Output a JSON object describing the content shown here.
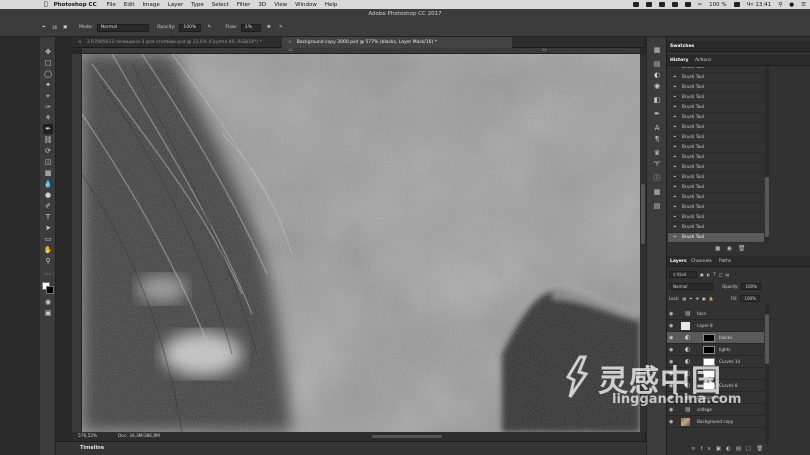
{
  "menubar": {
    "app_name": "Photoshop CC",
    "items": [
      "File",
      "Edit",
      "Image",
      "Layer",
      "Type",
      "Select",
      "Filter",
      "3D",
      "View",
      "Window",
      "Help"
    ],
    "battery": "100 %",
    "clock": "Чт 13:41"
  },
  "window": {
    "title": "Adobe Photoshop CC 2017"
  },
  "options_bar": {
    "brush_size": "16",
    "mode_label": "Mode:",
    "mode_value": "Normal",
    "opacity_label": "Opacity:",
    "opacity_value": "100%",
    "flow_label": "Flow:",
    "flow_value": "1%"
  },
  "tabs": [
    {
      "label": "3 R7005612-почищено-3 для стопбюк.psd @ 22,6% (Группа 40, RGB/16*) *"
    },
    {
      "label": "Background copy 3000.psd @ 577% (blacks, Layer Mask/16) *"
    }
  ],
  "ruler": {
    "tick_a": "13",
    "tick_b": "14"
  },
  "status": {
    "zoom": "576,53%",
    "doc": "Doc: 34,3M/386,8M"
  },
  "timeline": {
    "label": "Timeline"
  },
  "swatches": {
    "tab": "Swatches"
  },
  "history_panel": {
    "tabs": [
      "History",
      "Actions"
    ],
    "items": [
      "Brush Tool",
      "Brush Tool",
      "Brush Tool",
      "Brush Tool",
      "Brush Tool",
      "Brush Tool",
      "Brush Tool",
      "Brush Tool",
      "Brush Tool",
      "Brush Tool",
      "Brush Tool",
      "Brush Tool",
      "Brush Tool",
      "Brush Tool",
      "Brush Tool",
      "Brush Tool",
      "Brush Tool",
      "Brush Tool"
    ]
  },
  "layers_panel": {
    "tabs": [
      "Layers",
      "Channels",
      "Paths"
    ],
    "kind_filter": "Kind",
    "blend_mode": "Normal",
    "opacity_label": "Opacity:",
    "opacity_value": "100%",
    "lock_label": "Lock:",
    "fill_label": "Fill:",
    "fill_value": "100%",
    "layers": [
      {
        "name": "face",
        "kind": "group"
      },
      {
        "name": "Layer 8",
        "kind": "pixel"
      },
      {
        "name": "blacks",
        "kind": "adjustment-mask-black",
        "selected": true
      },
      {
        "name": "lights",
        "kind": "adjustment-mask-black"
      },
      {
        "name": "Curves 14",
        "kind": "adjustment-mask-white"
      },
      {
        "name": "",
        "kind": "adjustment-mask-white"
      },
      {
        "name": "Curves 8",
        "kind": "adjustment-mask-white"
      },
      {
        "name": "background",
        "kind": "group"
      },
      {
        "name": "collage",
        "kind": "group"
      },
      {
        "name": "Background copy",
        "kind": "image"
      }
    ]
  },
  "watermark": {
    "cn": "灵感中国",
    "url": "lingganchina.com"
  },
  "colors": {
    "panel": "#323232",
    "bar": "#3c3c3c",
    "menubar": "#d9d9d9",
    "selected": "#5a5a5a"
  }
}
